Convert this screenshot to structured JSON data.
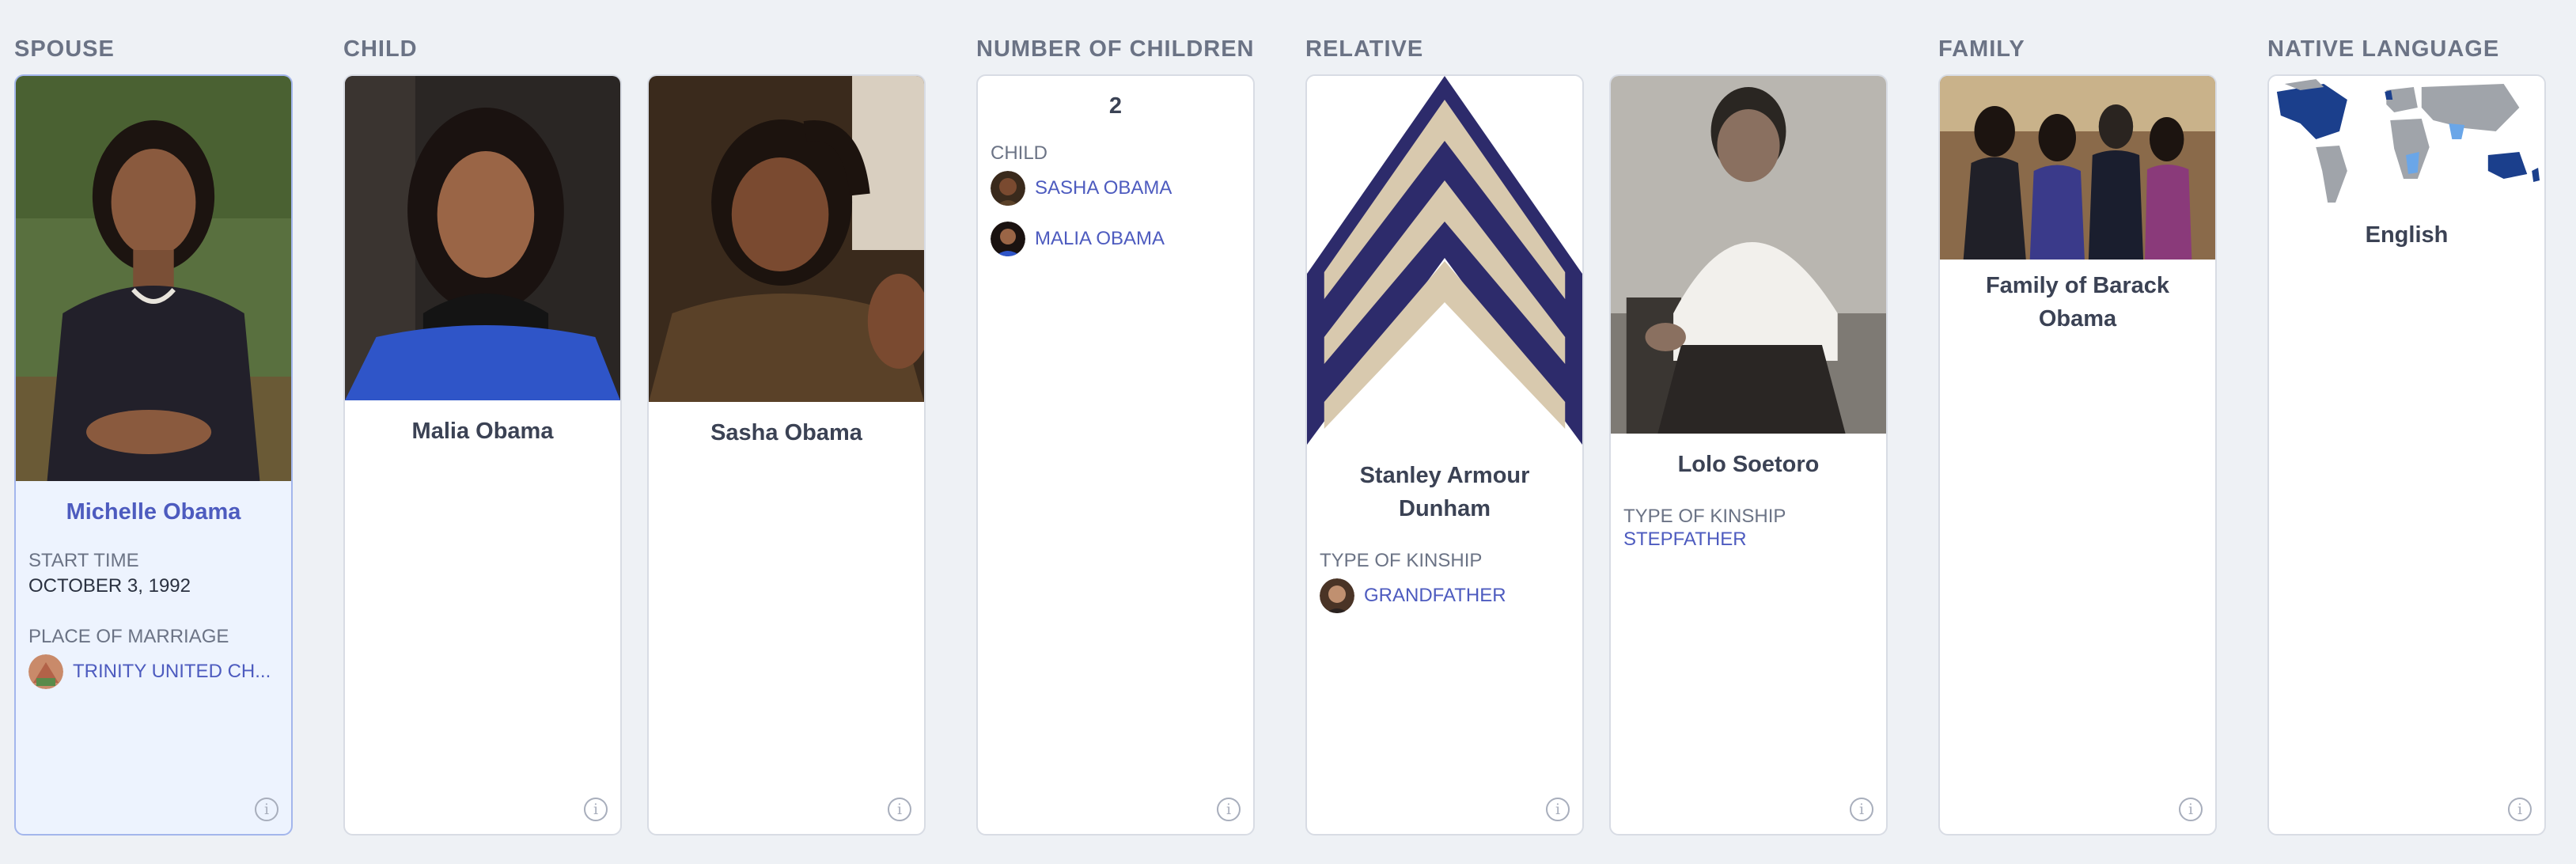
{
  "headings": {
    "spouse": "SPOUSE",
    "child": "CHILD",
    "number_of_children": "NUMBER OF CHILDREN",
    "relative": "RELATIVE",
    "family": "FAMILY",
    "native_language": "NATIVE LANGUAGE"
  },
  "spouse": {
    "name": "Michelle Obama",
    "start_time_label": "START TIME",
    "start_time_value": "OCTOBER 3, 1992",
    "place_label": "PLACE OF MARRIAGE",
    "place_value": "TRINITY UNITED CH..."
  },
  "children": [
    {
      "name": "Malia Obama"
    },
    {
      "name": "Sasha Obama"
    }
  ],
  "number_of_children": {
    "value": "2",
    "child_label": "CHILD",
    "items": [
      "SASHA OBAMA",
      "MALIA OBAMA"
    ]
  },
  "relatives": [
    {
      "name": "Stanley Armour Dunham",
      "kinship_label": "TYPE OF KINSHIP",
      "kinship_value": "GRANDFATHER"
    },
    {
      "name": "Lolo Soetoro",
      "kinship_label": "TYPE OF KINSHIP",
      "kinship_value": "STEPFATHER"
    }
  ],
  "family": {
    "name": "Family of Barack Obama"
  },
  "native_language": {
    "name": "English"
  },
  "info_glyph": "i",
  "colors": {
    "link": "#4d5bbf",
    "selected_bg": "#edf3fe",
    "selected_border": "#a3b6ec",
    "page_bg": "#eef1f5"
  },
  "icons": {
    "info": "info-circle-icon",
    "chevron_insignia": "sergeant-chevron-icon",
    "world_map": "world-map-icon"
  }
}
